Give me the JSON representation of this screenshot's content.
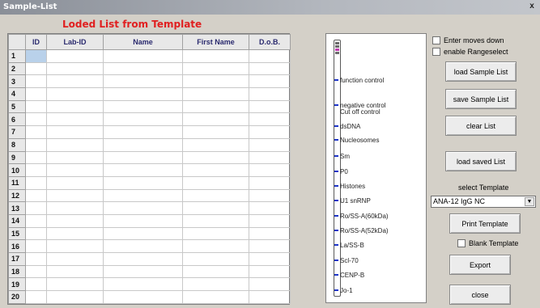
{
  "window": {
    "title": "Sample-List",
    "close": "x"
  },
  "list_title": "Loded List from Template",
  "grid": {
    "columns": [
      "ID",
      "Lab-ID",
      "Name",
      "First Name",
      "D.o.B."
    ],
    "rows": [
      "1",
      "2",
      "3",
      "4",
      "5",
      "6",
      "7",
      "8",
      "9",
      "10",
      "11",
      "12",
      "13",
      "14",
      "15",
      "16",
      "17",
      "18",
      "19",
      "20"
    ]
  },
  "strip": {
    "bands": [
      {
        "label": "function control"
      },
      {
        "label": "negative control"
      },
      {
        "label": "Cut off control"
      },
      {
        "label": "dsDNA"
      },
      {
        "label": "Nucleosomes"
      },
      {
        "label": "Sm"
      },
      {
        "label": "P0"
      },
      {
        "label": "Histones"
      },
      {
        "label": "U1 snRNP"
      },
      {
        "label": "Ro/SS-A(60kDa)"
      },
      {
        "label": "Ro/SS-A(52kDa)"
      },
      {
        "label": "La/SS-B"
      },
      {
        "label": "Scl-70"
      },
      {
        "label": "CENP-B"
      },
      {
        "label": "Jo-1"
      }
    ],
    "colors": {
      "band": "#1c33c9",
      "top_mark_1": "#6a6a6a",
      "top_mark_2": "#c03ab0"
    }
  },
  "options": {
    "enter_moves_down": "Enter moves down",
    "enable_rangeselect": "enable Rangeselect",
    "blank_template": "Blank Template"
  },
  "buttons": {
    "load_sample_list": "load Sample List",
    "save_sample_list": "save Sample List",
    "clear_list": "clear List",
    "load_saved_list": "load  saved List",
    "print_template": "Print Template",
    "export": "Export",
    "close": "close"
  },
  "template": {
    "label": "select Template",
    "selected": "ANA-12 IgG NC",
    "arrow": "▼"
  },
  "accent_title_color": "#e02020"
}
